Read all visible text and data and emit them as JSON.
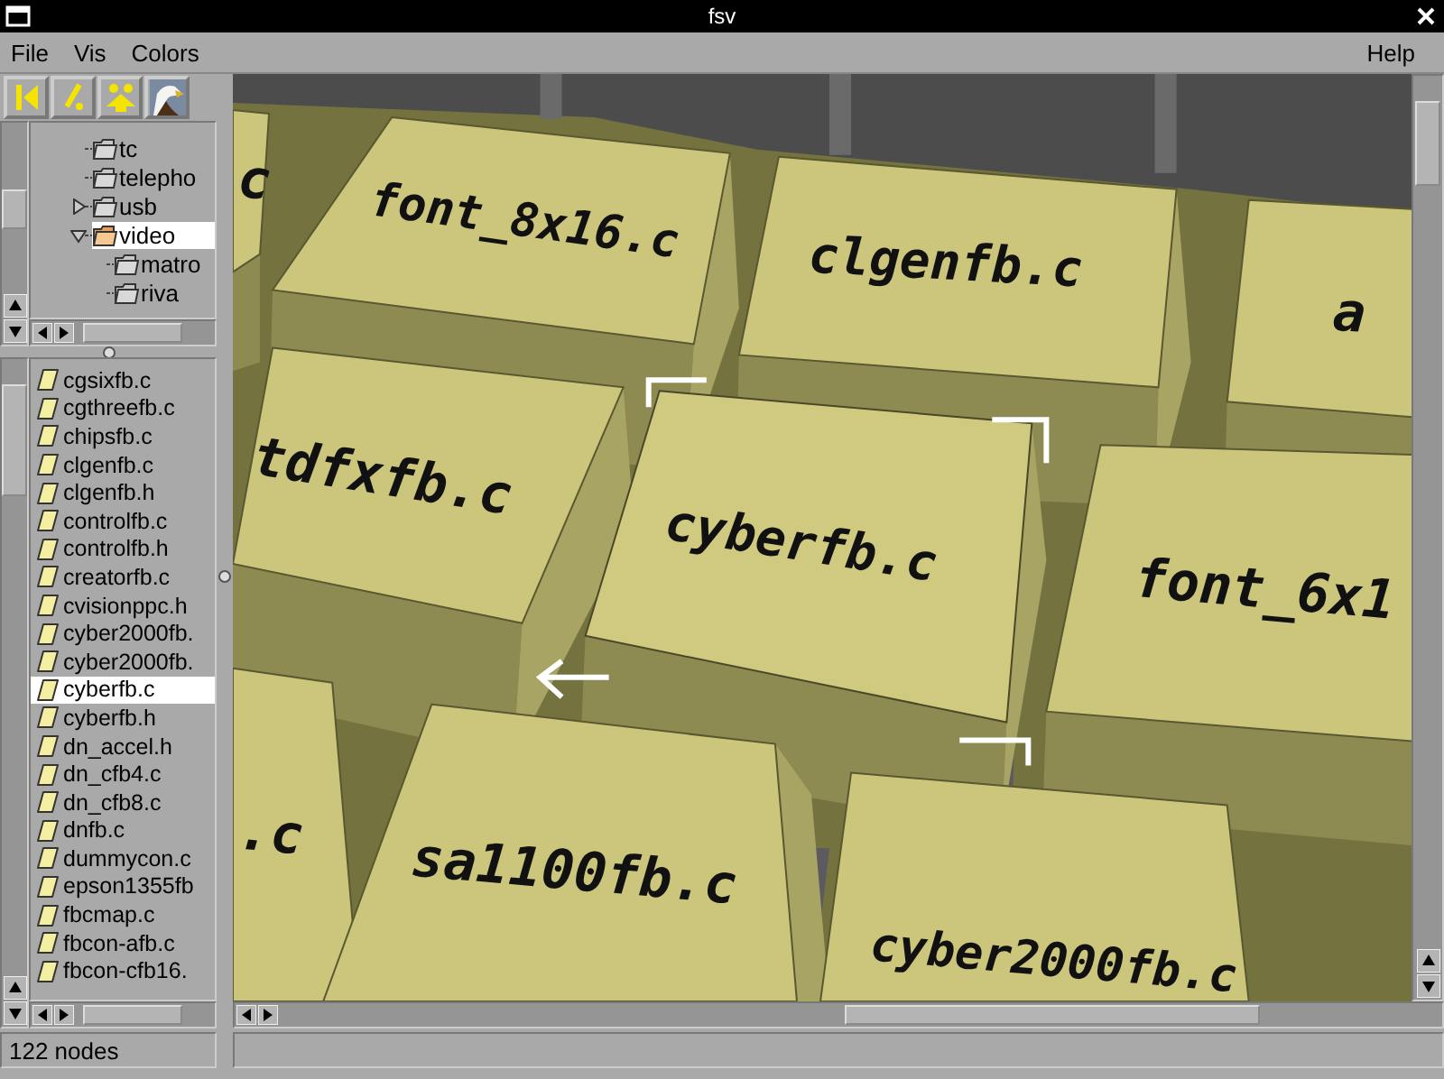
{
  "window": {
    "title": "fsv"
  },
  "menu": {
    "left": [
      "File",
      "Vis",
      "Colors"
    ],
    "right": [
      "Help"
    ]
  },
  "tree": [
    {
      "label": "tc",
      "selected": false
    },
    {
      "label": "telepho",
      "selected": false
    },
    {
      "label": "usb",
      "expanded": false,
      "selected": false
    },
    {
      "label": "video",
      "expanded": true,
      "selected": true,
      "children": [
        {
          "label": "matro",
          "selected": false
        },
        {
          "label": "riva",
          "selected": false
        }
      ]
    }
  ],
  "files": [
    {
      "label": "cgsixfb.c",
      "selected": false
    },
    {
      "label": "cgthreefb.c",
      "selected": false
    },
    {
      "label": "chipsfb.c",
      "selected": false
    },
    {
      "label": "clgenfb.c",
      "selected": false
    },
    {
      "label": "clgenfb.h",
      "selected": false
    },
    {
      "label": "controlfb.c",
      "selected": false
    },
    {
      "label": "controlfb.h",
      "selected": false
    },
    {
      "label": "creatorfb.c",
      "selected": false
    },
    {
      "label": "cvisionppc.h",
      "selected": false
    },
    {
      "label": "cyber2000fb.",
      "selected": false
    },
    {
      "label": "cyber2000fb.",
      "selected": false
    },
    {
      "label": "cyberfb.c",
      "selected": true
    },
    {
      "label": "cyberfb.h",
      "selected": false
    },
    {
      "label": "dn_accel.h",
      "selected": false
    },
    {
      "label": "dn_cfb4.c",
      "selected": false
    },
    {
      "label": "dn_cfb8.c",
      "selected": false
    },
    {
      "label": "dnfb.c",
      "selected": false
    },
    {
      "label": "dummycon.c",
      "selected": false
    },
    {
      "label": "epson1355fb",
      "selected": false
    },
    {
      "label": "fbcmap.c",
      "selected": false
    },
    {
      "label": "fbcon-afb.c",
      "selected": false
    },
    {
      "label": "fbcon-cfb16.",
      "selected": false
    }
  ],
  "left_status": "122 nodes",
  "view": {
    "blocks": [
      {
        "label": "c",
        "highlighted": false
      },
      {
        "label": "font_8x16.c",
        "highlighted": false
      },
      {
        "label": "clgenfb.c",
        "highlighted": false
      },
      {
        "label": "a",
        "highlighted": false
      },
      {
        "label": "tdfxfb.c",
        "highlighted": false
      },
      {
        "label": "cyberfb.c",
        "highlighted": true
      },
      {
        "label": "font_6x1",
        "highlighted": false
      },
      {
        "label": ".c",
        "highlighted": false
      },
      {
        "label": "sa1100fb.c",
        "highlighted": false
      },
      {
        "label": "cyber2000fb.c",
        "highlighted": false
      }
    ]
  }
}
